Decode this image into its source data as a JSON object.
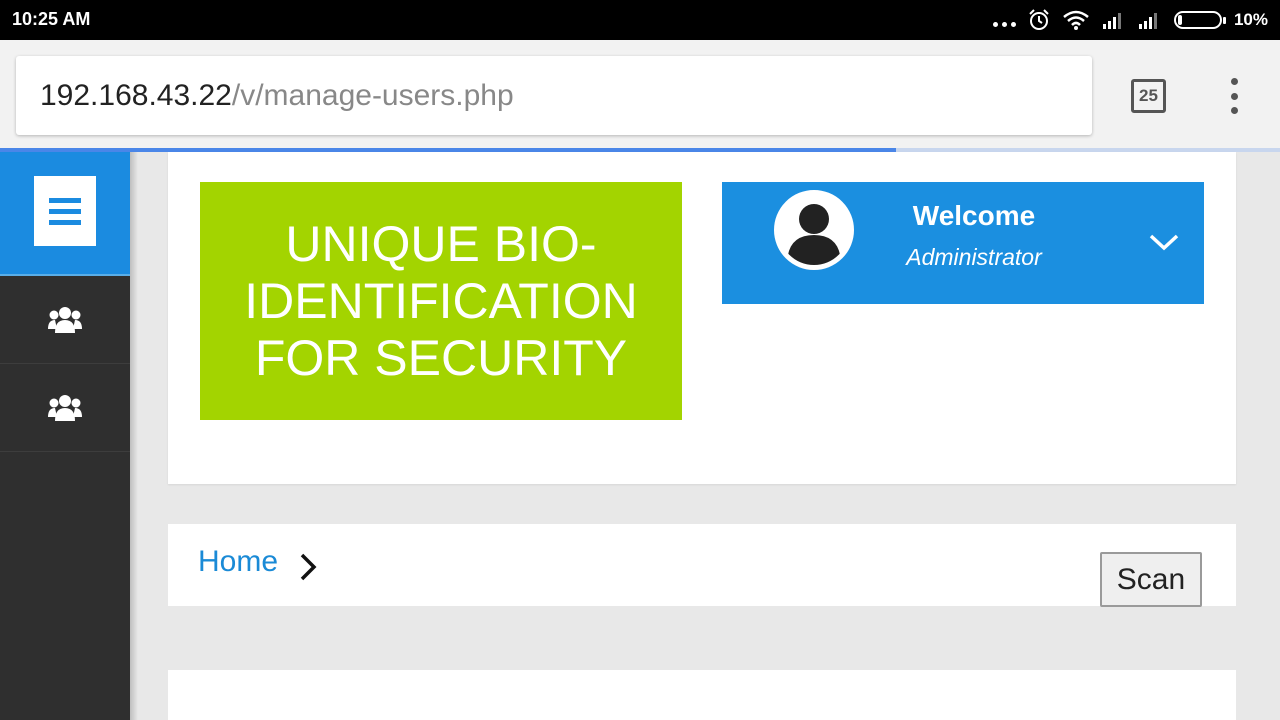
{
  "status_bar": {
    "time": "10:25 AM",
    "battery_percent": "10%",
    "icons": [
      "more-dots-icon",
      "alarm-icon",
      "wifi-icon",
      "signal-icon",
      "signal-icon",
      "battery-icon"
    ]
  },
  "browser": {
    "url_host": "192.168.43.22",
    "url_path": "/v/manage-users.php",
    "tab_count": "25",
    "load_progress": 0.7
  },
  "sidebar": {
    "menu_icon": "hamburger-icon",
    "items": [
      {
        "icon": "users-icon"
      },
      {
        "icon": "users-icon"
      }
    ]
  },
  "header": {
    "logo_text": "UNIQUE BIO-IDENTIFICATION FOR SECURITY",
    "welcome_title": "Welcome",
    "welcome_role": "Administrator"
  },
  "breadcrumb": {
    "home_label": "Home",
    "scan_label": "Scan"
  },
  "colors": {
    "accent_blue": "#1b8fe0",
    "logo_green": "#a3d400",
    "sidebar_dark": "#2f2f2f",
    "link_blue": "#1a8ad6"
  }
}
